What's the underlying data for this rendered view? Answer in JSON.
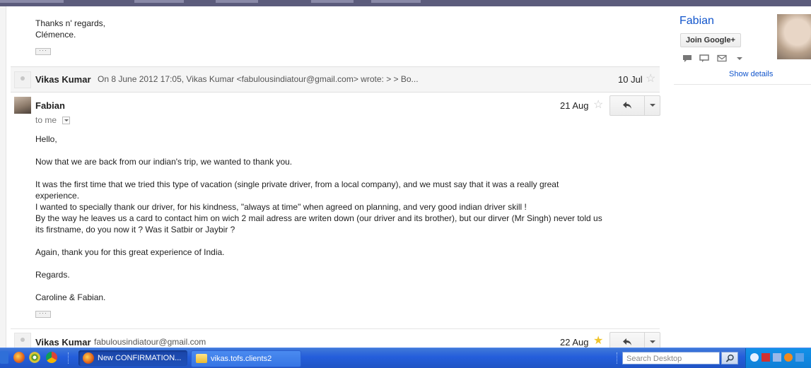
{
  "thread": {
    "prev_signature": [
      "Thanks n' regards,",
      "Clémence."
    ],
    "ellipsis": "···",
    "collapsed_msg": {
      "sender": "Vikas Kumar",
      "snippet": "On 8 June 2012 17:05, Vikas Kumar <fabulousindiatour@gmail.com> wrote: > > Bo...",
      "date": "10 Jul",
      "star": "☆"
    },
    "expanded_msg": {
      "sender": "Fabian",
      "recipient": "to me",
      "date": "21 Aug",
      "star": "☆",
      "body": [
        "Hello,",
        "Now that we are back from our indian's trip, we wanted to thank you.",
        "It was the first time that we tried this type of vacation (single private driver, from a local company), and we must say that it was a really great",
        "experience.",
        "I wanted to specially thank our driver, for his kindness, \"always at time\" when agreed on planning, and very good indian driver skill !",
        "By the way he leaves us a card to contact him on wich 2 mail adress are writen down (our driver and its brother), but our dirver (Mr Singh) never told us",
        "its firstname, do you now it ? Was it Satbir or Jaybir ?",
        "Again, thank you for this great experience of India.",
        "Regards.",
        "Caroline & Fabian."
      ]
    },
    "last_msg": {
      "sender": "Vikas Kumar",
      "email": "fabulousindiatour@gmail.com",
      "date": "22 Aug",
      "star": "★"
    }
  },
  "side_panel": {
    "name": "Fabian",
    "join_button": "Join Google+",
    "show_details": "Show details"
  },
  "taskbar": {
    "windows": [
      {
        "label": "New CONFIRMATION...",
        "icon": "firefox-icon",
        "active": true
      },
      {
        "label": "vikas.tofs.clients2",
        "icon": "folder-icon",
        "active": false
      }
    ],
    "search_placeholder": "Search Desktop",
    "colors": {
      "taskbar": "#245edb",
      "tray": "#0f7fd7"
    }
  }
}
